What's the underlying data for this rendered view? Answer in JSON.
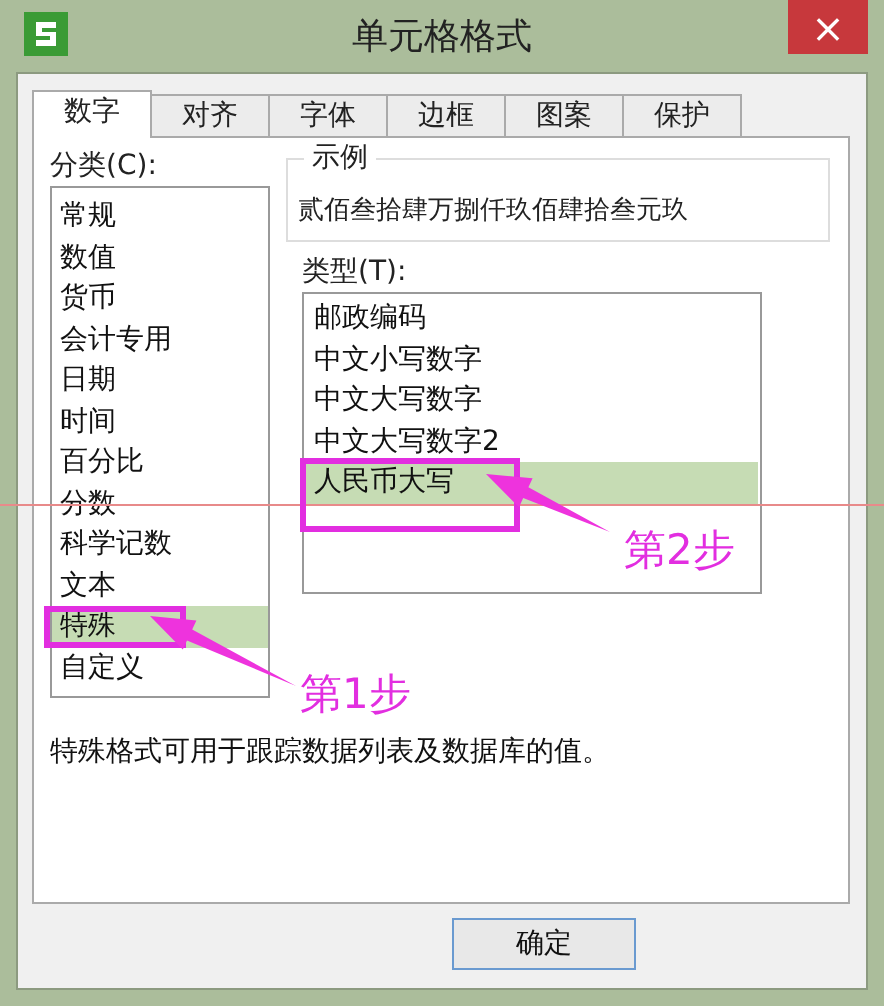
{
  "window": {
    "title": "单元格格式",
    "close": "×"
  },
  "tabs": [
    {
      "label": "数字",
      "selected": true
    },
    {
      "label": "对齐",
      "selected": false
    },
    {
      "label": "字体",
      "selected": false
    },
    {
      "label": "边框",
      "selected": false
    },
    {
      "label": "图案",
      "selected": false
    },
    {
      "label": "保护",
      "selected": false
    }
  ],
  "category": {
    "label": "分类(C):",
    "items": [
      {
        "label": "常规",
        "selected": false
      },
      {
        "label": "数值",
        "selected": false
      },
      {
        "label": "货币",
        "selected": false
      },
      {
        "label": "会计专用",
        "selected": false
      },
      {
        "label": "日期",
        "selected": false
      },
      {
        "label": "时间",
        "selected": false
      },
      {
        "label": "百分比",
        "selected": false
      },
      {
        "label": "分数",
        "selected": false
      },
      {
        "label": "科学记数",
        "selected": false
      },
      {
        "label": "文本",
        "selected": false
      },
      {
        "label": "特殊",
        "selected": true
      },
      {
        "label": "自定义",
        "selected": false
      }
    ]
  },
  "sample": {
    "label": "示例",
    "value": "贰佰叁拾肆万捌仟玖佰肆拾叁元玖"
  },
  "type": {
    "label": "类型(T):",
    "items": [
      {
        "label": "邮政编码",
        "selected": false
      },
      {
        "label": "中文小写数字",
        "selected": false
      },
      {
        "label": "中文大写数字",
        "selected": false
      },
      {
        "label": "中文大写数字2",
        "selected": false
      },
      {
        "label": "人民币大写",
        "selected": true
      }
    ]
  },
  "description": "特殊格式可用于跟踪数据列表及数据库的值。",
  "buttons": [
    "确定"
  ],
  "annotations": [
    {
      "label": "第1步"
    },
    {
      "label": "第2步"
    }
  ]
}
